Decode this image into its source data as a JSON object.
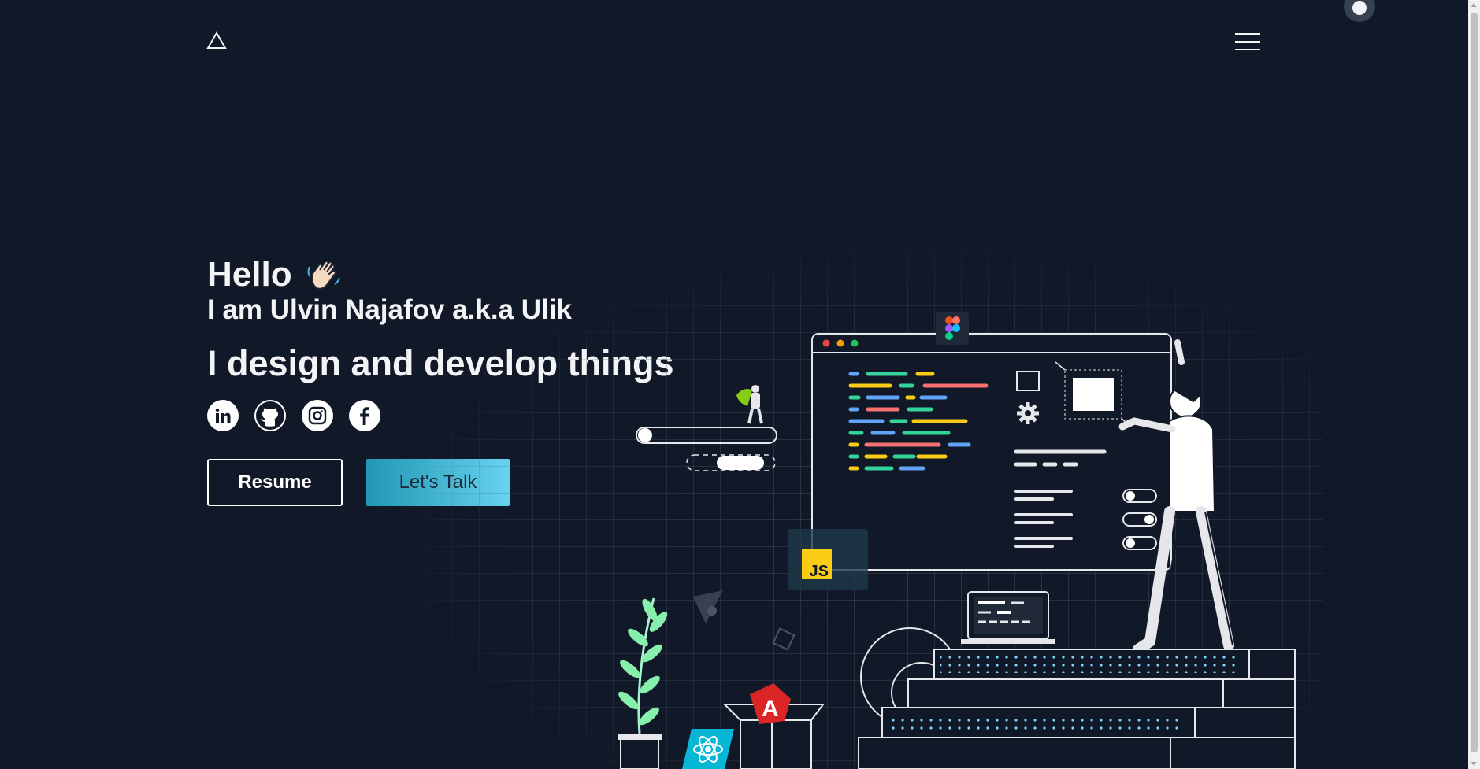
{
  "header": {
    "logo_icon": "triangle-logo-icon",
    "menu_icon": "hamburger-menu-icon",
    "theme_toggle_icon": "theme-toggle-icon"
  },
  "hero": {
    "greeting": "Hello",
    "greeting_emoji": "waving-hand-icon",
    "intro": "I am Ulvin Najafov a.k.a Ulik",
    "tagline": "I design and develop things",
    "socials": [
      {
        "name": "linkedin",
        "icon": "linkedin-icon"
      },
      {
        "name": "github",
        "icon": "github-icon"
      },
      {
        "name": "instagram",
        "icon": "instagram-icon"
      },
      {
        "name": "facebook",
        "icon": "facebook-icon"
      }
    ],
    "buttons": {
      "resume": "Resume",
      "talk": "Let's Talk"
    }
  },
  "illustration": {
    "js_badge": "JS",
    "icons": [
      "figma-icon",
      "javascript-icon",
      "react-icon",
      "angular-icon",
      "superhero-figure",
      "plant-icon",
      "gear-icon",
      "laptop-icon",
      "developer-figure"
    ]
  },
  "colors": {
    "background": "#111827",
    "accent_start": "#2196b3",
    "accent_end": "#66d3ef",
    "text": "#f3f4f6"
  }
}
